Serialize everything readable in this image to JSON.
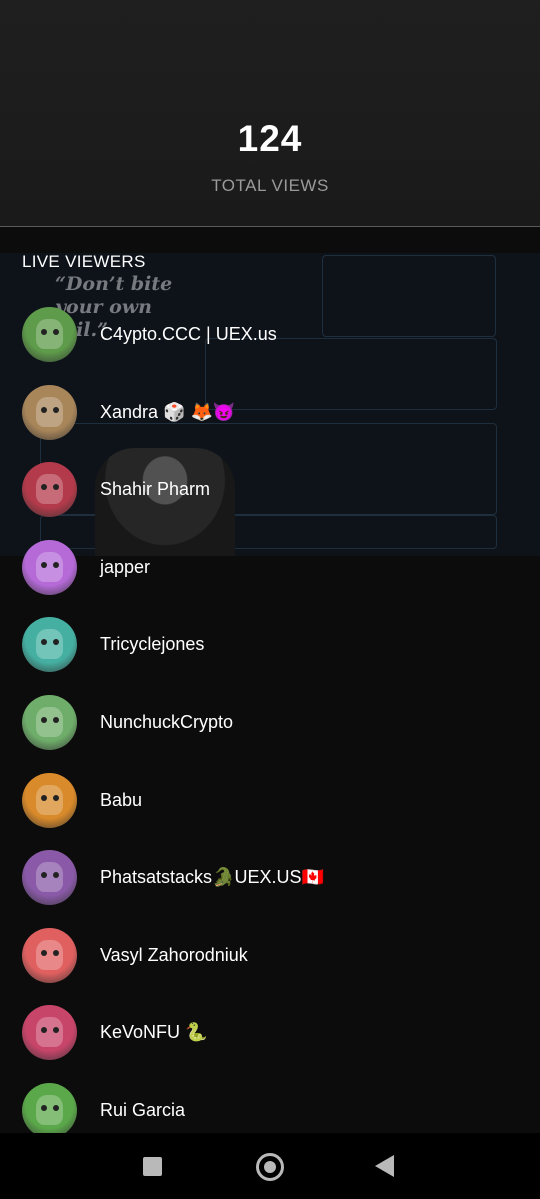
{
  "stats": {
    "total_views": "124",
    "total_views_label": "TOTAL VIEWS"
  },
  "live_viewers_label": "LIVE VIEWERS",
  "background_video": {
    "quote": "“Don’t bite your own tail.”"
  },
  "viewers": [
    {
      "name": "C4ypto.CCC | UEX.us",
      "avatar_color": "#5e9b4a"
    },
    {
      "name": "Xandra 🎲 🦊😈",
      "avatar_color": "#a9865a"
    },
    {
      "name": "Shahir Pharm",
      "avatar_color": "#b33a4a"
    },
    {
      "name": "japper",
      "avatar_color": "#b56ad8"
    },
    {
      "name": "Tricyclejones",
      "avatar_color": "#45b0a2"
    },
    {
      "name": "NunchuckCrypto",
      "avatar_color": "#6fae6a"
    },
    {
      "name": "Babu",
      "avatar_color": "#d98a2a"
    },
    {
      "name": "Phatsatstacks🐊UEX.US🇨🇦",
      "avatar_color": "#8a5aa8"
    },
    {
      "name": "Vasyl Zahorodniuk",
      "avatar_color": "#e06060"
    },
    {
      "name": "KeVoNFU 🐍",
      "avatar_color": "#c8456a"
    },
    {
      "name": "Rui Garcia",
      "avatar_color": "#5ba84a"
    }
  ],
  "navbar": {
    "recents_icon": "square-icon",
    "home_icon": "circle-icon",
    "back_icon": "triangle-back-icon"
  }
}
